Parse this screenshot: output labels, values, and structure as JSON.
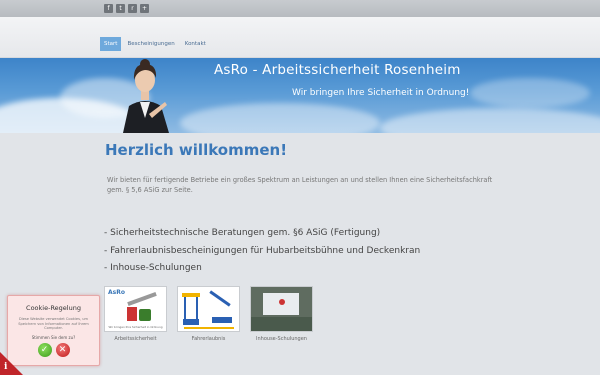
{
  "social_icons": [
    {
      "name": "facebook-icon",
      "glyph": "f"
    },
    {
      "name": "twitter-icon",
      "glyph": "t"
    },
    {
      "name": "rss-icon",
      "glyph": "r"
    },
    {
      "name": "share-icon",
      "glyph": "+"
    }
  ],
  "nav": {
    "items": [
      {
        "label": "Start",
        "active": true
      },
      {
        "label": "Bescheinigungen",
        "active": false
      },
      {
        "label": "Kontakt",
        "active": false
      }
    ]
  },
  "banner": {
    "title": "AsRo - Arbeitssicherheit Rosenheim",
    "subtitle": "Wir bringen Ihre Sicherheit in Ordnung!"
  },
  "main": {
    "heading": "Herzlich willkommen!",
    "intro": "Wir bieten für fertigende Betriebe ein großes Spektrum an Leistungen an und stellen Ihnen eine Sicherheitsfachkraft gem. § 5,6 ASiG zur Seite.",
    "services": [
      "- Sicherheitstechnische Beratungen gem. §6 ASiG (Fertigung)",
      "- Fahrerlaubnisbescheinigungen für Hubarbeitsbühne und Deckenkran",
      "- Inhouse-Schulungen"
    ]
  },
  "gallery": [
    {
      "caption": "Arbeitssicherheit",
      "thumb_label": "AsRo",
      "thumb_sub": "Wir bringen Ihre Sicherheit in Ordnung"
    },
    {
      "caption": "Fahrerlaubnis"
    },
    {
      "caption": "Inhouse-Schulungen"
    }
  ],
  "cookie": {
    "title": "Cookie-Regelung",
    "text": "Diese Website verwendet Cookies, um Speichern von Informationen auf Ihrem Computer.",
    "question": "Stimmen Sie dem zu?",
    "accept_icon": "check-icon",
    "decline_icon": "cross-icon"
  },
  "info_badge": "i",
  "colors": {
    "accent": "#6ea9dc",
    "heading": "#3b78b8",
    "banner": "#4a8fd0"
  }
}
